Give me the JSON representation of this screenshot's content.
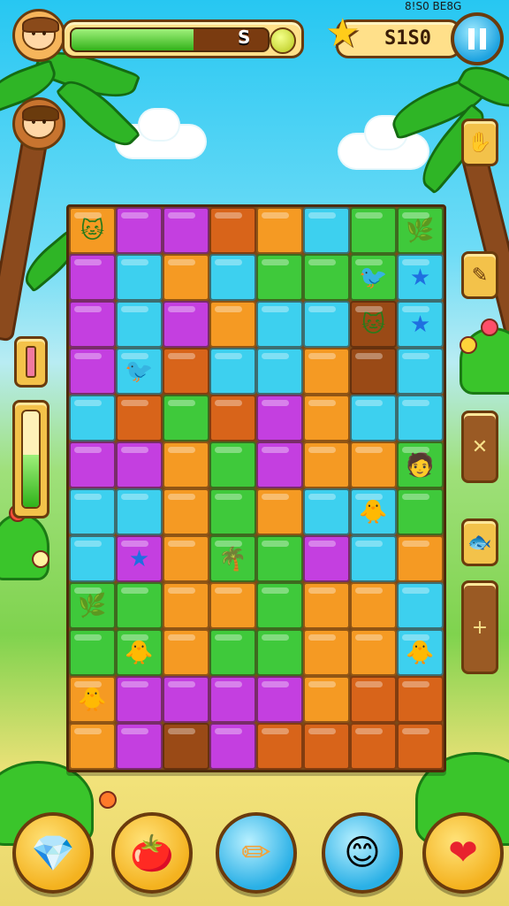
{
  "hud": {
    "score_top_text": "8!S0 BE8G",
    "score_value": "S1S0",
    "energy_badge": "S",
    "energy_fill": 0.62,
    "pause_icon": "pause-icon",
    "star_icon": "star-icon"
  },
  "left_tool": {
    "fill": 0.55
  },
  "board": {
    "cols": 8,
    "rows": 12,
    "palette": {
      "o": "#f59a23",
      "p": "#c43fe0",
      "c": "#3dd0ef",
      "g": "#3fc93b",
      "d": "#d8641a",
      "b": "#9a4a16",
      "y": "#f8b73a"
    },
    "cells": [
      [
        "o",
        "p",
        "p",
        "d",
        "o",
        "c",
        "g",
        "g"
      ],
      [
        "p",
        "c",
        "o",
        "c",
        "g",
        "g",
        "g",
        "c"
      ],
      [
        "p",
        "c",
        "p",
        "o",
        "c",
        "c",
        "b",
        "c"
      ],
      [
        "p",
        "c",
        "d",
        "c",
        "c",
        "o",
        "b",
        "c"
      ],
      [
        "c",
        "d",
        "g",
        "d",
        "p",
        "o",
        "c",
        "c"
      ],
      [
        "p",
        "p",
        "o",
        "g",
        "p",
        "o",
        "o",
        "g"
      ],
      [
        "c",
        "c",
        "o",
        "g",
        "o",
        "c",
        "c",
        "g"
      ],
      [
        "c",
        "p",
        "o",
        "g",
        "g",
        "p",
        "c",
        "o"
      ],
      [
        "g",
        "g",
        "o",
        "o",
        "g",
        "o",
        "o",
        "c"
      ],
      [
        "g",
        "g",
        "o",
        "g",
        "g",
        "o",
        "o",
        "c"
      ],
      [
        "o",
        "p",
        "p",
        "p",
        "p",
        "o",
        "d",
        "d"
      ],
      [
        "o",
        "p",
        "b",
        "p",
        "d",
        "d",
        "d",
        "d"
      ]
    ]
  },
  "bottom_buttons": [
    {
      "name": "heart-gem-button",
      "glyph": "💎"
    },
    {
      "name": "tomato-character-button",
      "glyph": "🍅"
    },
    {
      "name": "pencil-tool-button",
      "glyph": "✏"
    },
    {
      "name": "smiley-character-button",
      "glyph": "😊"
    },
    {
      "name": "heart-life-button",
      "glyph": "❤"
    }
  ],
  "right_buttons": [
    {
      "name": "hand-tool-button",
      "glyph": "✋"
    },
    {
      "name": "pencil-side-button",
      "glyph": "✎"
    },
    {
      "name": "scroll-map-button",
      "glyph": "✕"
    },
    {
      "name": "fish-button",
      "glyph": "🐟"
    },
    {
      "name": "plus-button",
      "glyph": "+"
    }
  ]
}
